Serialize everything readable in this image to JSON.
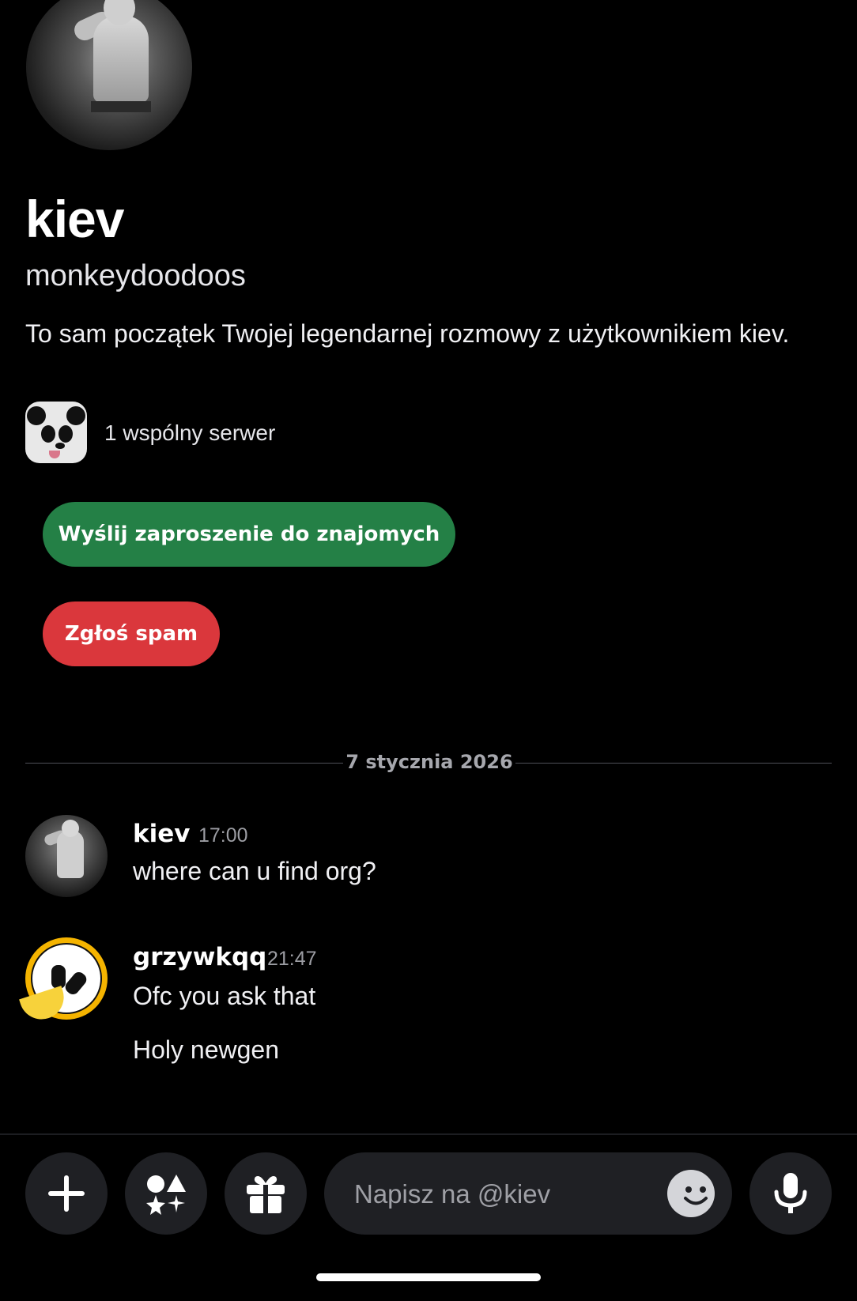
{
  "profile": {
    "display_name": "kiev",
    "username": "monkeydoodoos",
    "intro": "To sam początek Twojej legendarnej rozmowy z użytkownikiem kiev.",
    "mutual_servers": "1 wspólny serwer"
  },
  "actions": {
    "add_friend": "Wyślij zaproszenie do znajomych",
    "report_spam": "Zgłoś spam"
  },
  "date_divider": "7 stycznia 2026",
  "messages": [
    {
      "author": "kiev",
      "time": "17:00",
      "lines": [
        "where can u find org?"
      ]
    },
    {
      "author": "grzywkqq",
      "time": "21:47",
      "lines": [
        "Ofc you ask that",
        "Holy newgen"
      ]
    }
  ],
  "composer": {
    "placeholder": "Napisz na @kiev"
  },
  "colors": {
    "friend_button": "#248046",
    "spam_button": "#da373c",
    "background": "#000000",
    "input_background": "#1f2024"
  },
  "icons": {
    "plus": "plus-icon",
    "apps": "apps-icon",
    "gift": "gift-icon",
    "emoji": "emoji-icon",
    "mic": "microphone-icon"
  }
}
